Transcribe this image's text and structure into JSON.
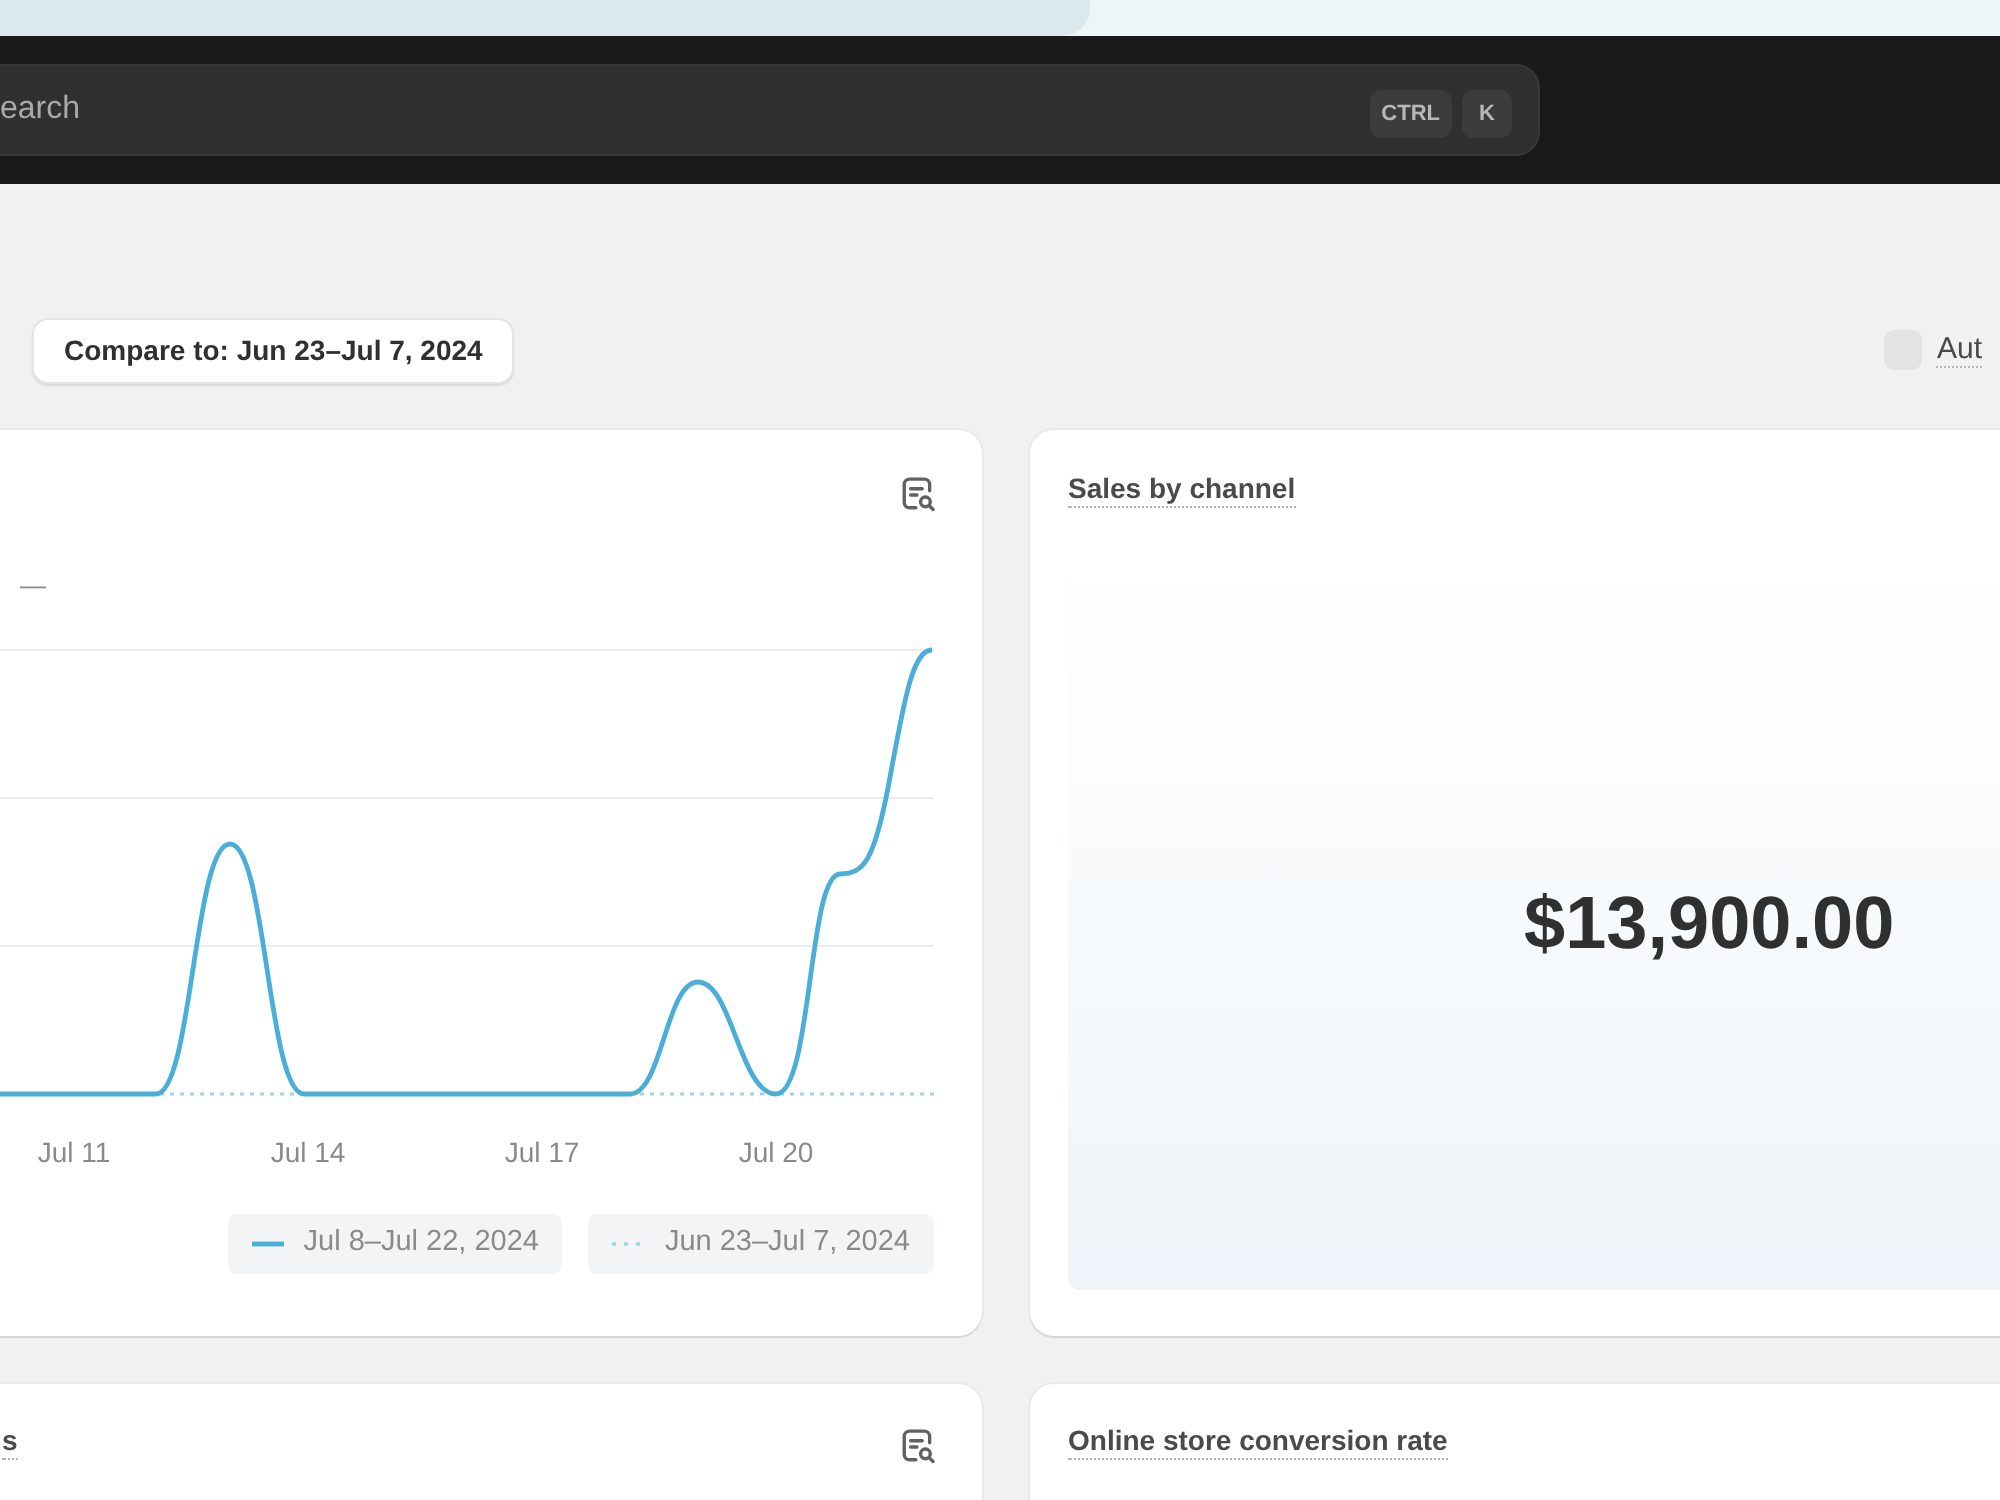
{
  "top_bar": {
    "search": {
      "placeholder": "earch",
      "shortcut_keys": [
        "CTRL",
        "K"
      ]
    }
  },
  "toolbar": {
    "compare_button": "Compare to: Jun 23–Jul 7, 2024",
    "auto_refresh": {
      "label": "Aut",
      "checked": false
    }
  },
  "cards": [
    {
      "kind": "line_chart",
      "explore": true,
      "value": "—",
      "x_labels": [
        "Jul 11",
        "Jul 14",
        "Jul 17",
        "Jul 20"
      ],
      "legend": [
        {
          "label": "Jul 8–Jul 22, 2024",
          "kind": "solid"
        },
        {
          "label": "Jun 23–Jul 7, 2024",
          "kind": "dotted"
        }
      ]
    },
    {
      "kind": "total",
      "explore": false,
      "title": "Sales by channel",
      "value": "$13,900.00"
    },
    {
      "kind": "header",
      "explore": true,
      "title": "s"
    },
    {
      "kind": "header",
      "explore": false,
      "title": "Online store conversion rate"
    }
  ]
}
